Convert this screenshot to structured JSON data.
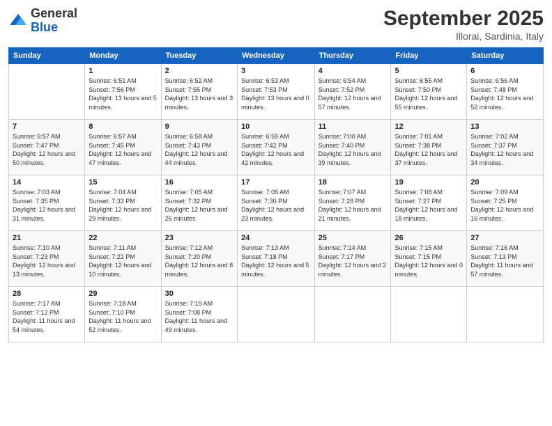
{
  "header": {
    "logo_line1": "General",
    "logo_line2": "Blue",
    "month_title": "September 2025",
    "location": "Illorai, Sardinia, Italy"
  },
  "weekdays": [
    "Sunday",
    "Monday",
    "Tuesday",
    "Wednesday",
    "Thursday",
    "Friday",
    "Saturday"
  ],
  "weeks": [
    [
      {
        "day": "",
        "sunrise": "",
        "sunset": "",
        "daylight": ""
      },
      {
        "day": "1",
        "sunrise": "Sunrise: 6:51 AM",
        "sunset": "Sunset: 7:56 PM",
        "daylight": "Daylight: 13 hours and 5 minutes."
      },
      {
        "day": "2",
        "sunrise": "Sunrise: 6:52 AM",
        "sunset": "Sunset: 7:55 PM",
        "daylight": "Daylight: 13 hours and 3 minutes."
      },
      {
        "day": "3",
        "sunrise": "Sunrise: 6:53 AM",
        "sunset": "Sunset: 7:53 PM",
        "daylight": "Daylight: 13 hours and 0 minutes."
      },
      {
        "day": "4",
        "sunrise": "Sunrise: 6:54 AM",
        "sunset": "Sunset: 7:52 PM",
        "daylight": "Daylight: 12 hours and 57 minutes."
      },
      {
        "day": "5",
        "sunrise": "Sunrise: 6:55 AM",
        "sunset": "Sunset: 7:50 PM",
        "daylight": "Daylight: 12 hours and 55 minutes."
      },
      {
        "day": "6",
        "sunrise": "Sunrise: 6:56 AM",
        "sunset": "Sunset: 7:48 PM",
        "daylight": "Daylight: 12 hours and 52 minutes."
      }
    ],
    [
      {
        "day": "7",
        "sunrise": "Sunrise: 6:57 AM",
        "sunset": "Sunset: 7:47 PM",
        "daylight": "Daylight: 12 hours and 50 minutes."
      },
      {
        "day": "8",
        "sunrise": "Sunrise: 6:57 AM",
        "sunset": "Sunset: 7:45 PM",
        "daylight": "Daylight: 12 hours and 47 minutes."
      },
      {
        "day": "9",
        "sunrise": "Sunrise: 6:58 AM",
        "sunset": "Sunset: 7:43 PM",
        "daylight": "Daylight: 12 hours and 44 minutes."
      },
      {
        "day": "10",
        "sunrise": "Sunrise: 6:59 AM",
        "sunset": "Sunset: 7:42 PM",
        "daylight": "Daylight: 12 hours and 42 minutes."
      },
      {
        "day": "11",
        "sunrise": "Sunrise: 7:00 AM",
        "sunset": "Sunset: 7:40 PM",
        "daylight": "Daylight: 12 hours and 39 minutes."
      },
      {
        "day": "12",
        "sunrise": "Sunrise: 7:01 AM",
        "sunset": "Sunset: 7:38 PM",
        "daylight": "Daylight: 12 hours and 37 minutes."
      },
      {
        "day": "13",
        "sunrise": "Sunrise: 7:02 AM",
        "sunset": "Sunset: 7:37 PM",
        "daylight": "Daylight: 12 hours and 34 minutes."
      }
    ],
    [
      {
        "day": "14",
        "sunrise": "Sunrise: 7:03 AM",
        "sunset": "Sunset: 7:35 PM",
        "daylight": "Daylight: 12 hours and 31 minutes."
      },
      {
        "day": "15",
        "sunrise": "Sunrise: 7:04 AM",
        "sunset": "Sunset: 7:33 PM",
        "daylight": "Daylight: 12 hours and 29 minutes."
      },
      {
        "day": "16",
        "sunrise": "Sunrise: 7:05 AM",
        "sunset": "Sunset: 7:32 PM",
        "daylight": "Daylight: 12 hours and 26 minutes."
      },
      {
        "day": "17",
        "sunrise": "Sunrise: 7:06 AM",
        "sunset": "Sunset: 7:30 PM",
        "daylight": "Daylight: 12 hours and 23 minutes."
      },
      {
        "day": "18",
        "sunrise": "Sunrise: 7:07 AM",
        "sunset": "Sunset: 7:28 PM",
        "daylight": "Daylight: 12 hours and 21 minutes."
      },
      {
        "day": "19",
        "sunrise": "Sunrise: 7:08 AM",
        "sunset": "Sunset: 7:27 PM",
        "daylight": "Daylight: 12 hours and 18 minutes."
      },
      {
        "day": "20",
        "sunrise": "Sunrise: 7:09 AM",
        "sunset": "Sunset: 7:25 PM",
        "daylight": "Daylight: 12 hours and 16 minutes."
      }
    ],
    [
      {
        "day": "21",
        "sunrise": "Sunrise: 7:10 AM",
        "sunset": "Sunset: 7:23 PM",
        "daylight": "Daylight: 12 hours and 13 minutes."
      },
      {
        "day": "22",
        "sunrise": "Sunrise: 7:11 AM",
        "sunset": "Sunset: 7:22 PM",
        "daylight": "Daylight: 12 hours and 10 minutes."
      },
      {
        "day": "23",
        "sunrise": "Sunrise: 7:12 AM",
        "sunset": "Sunset: 7:20 PM",
        "daylight": "Daylight: 12 hours and 8 minutes."
      },
      {
        "day": "24",
        "sunrise": "Sunrise: 7:13 AM",
        "sunset": "Sunset: 7:18 PM",
        "daylight": "Daylight: 12 hours and 5 minutes."
      },
      {
        "day": "25",
        "sunrise": "Sunrise: 7:14 AM",
        "sunset": "Sunset: 7:17 PM",
        "daylight": "Daylight: 12 hours and 2 minutes."
      },
      {
        "day": "26",
        "sunrise": "Sunrise: 7:15 AM",
        "sunset": "Sunset: 7:15 PM",
        "daylight": "Daylight: 12 hours and 0 minutes."
      },
      {
        "day": "27",
        "sunrise": "Sunrise: 7:16 AM",
        "sunset": "Sunset: 7:13 PM",
        "daylight": "Daylight: 11 hours and 57 minutes."
      }
    ],
    [
      {
        "day": "28",
        "sunrise": "Sunrise: 7:17 AM",
        "sunset": "Sunset: 7:12 PM",
        "daylight": "Daylight: 11 hours and 54 minutes."
      },
      {
        "day": "29",
        "sunrise": "Sunrise: 7:18 AM",
        "sunset": "Sunset: 7:10 PM",
        "daylight": "Daylight: 11 hours and 52 minutes."
      },
      {
        "day": "30",
        "sunrise": "Sunrise: 7:19 AM",
        "sunset": "Sunset: 7:08 PM",
        "daylight": "Daylight: 11 hours and 49 minutes."
      },
      {
        "day": "",
        "sunrise": "",
        "sunset": "",
        "daylight": ""
      },
      {
        "day": "",
        "sunrise": "",
        "sunset": "",
        "daylight": ""
      },
      {
        "day": "",
        "sunrise": "",
        "sunset": "",
        "daylight": ""
      },
      {
        "day": "",
        "sunrise": "",
        "sunset": "",
        "daylight": ""
      }
    ]
  ]
}
